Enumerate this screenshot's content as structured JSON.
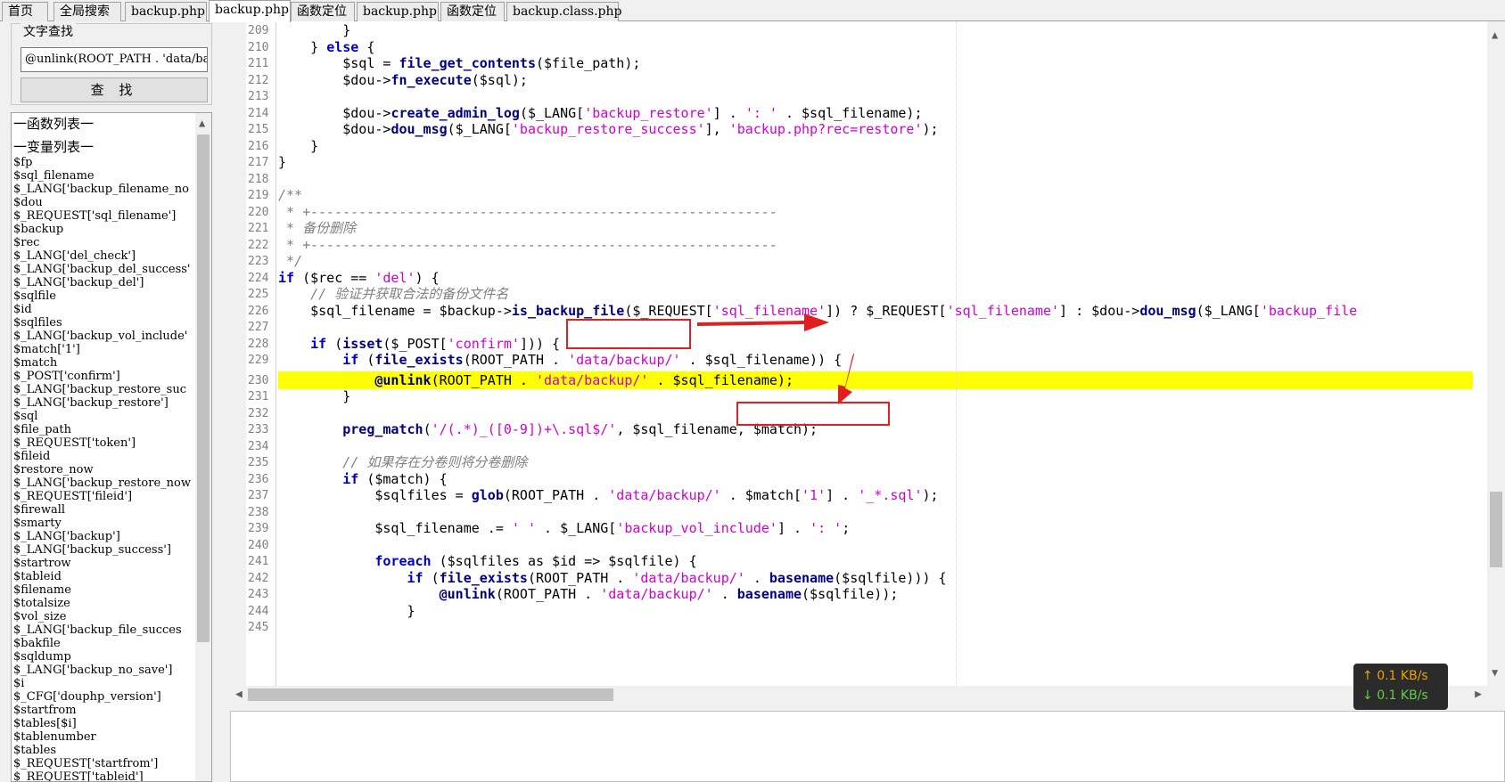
{
  "tabs": [
    {
      "label": "首页",
      "active": false
    },
    {
      "label": "全局搜索",
      "active": false
    },
    {
      "label": "backup.php",
      "active": false
    },
    {
      "label": "backup.php",
      "active": true
    },
    {
      "label": "函数定位",
      "active": false
    },
    {
      "label": "backup.php",
      "active": false
    },
    {
      "label": "函数定位",
      "active": false
    },
    {
      "label": "backup.class.php",
      "active": false
    }
  ],
  "find": {
    "title": "文字查找",
    "input_value": "@unlink(ROOT_PATH . 'data/ba",
    "button_label": "查 找"
  },
  "lists": {
    "functions_header": "一函数列表一",
    "variables_header": "一变量列表一",
    "variables": [
      "$fp",
      "$sql_filename",
      "$_LANG['backup_filename_no",
      "$dou",
      "$_REQUEST['sql_filename']",
      "$backup",
      "$rec",
      "$_LANG['del_check']",
      "$_LANG['backup_del_success'",
      "$_LANG['backup_del']",
      "$sqlfile",
      "$id",
      "$sqlfiles",
      "$_LANG['backup_vol_include'",
      "$match['1']",
      "$match",
      "$_POST['confirm']",
      "$_LANG['backup_restore_suc",
      "$_LANG['backup_restore']",
      "$sql",
      "$file_path",
      "$_REQUEST['token']",
      "$fileid",
      "$restore_now",
      "$_LANG['backup_restore_now'",
      "$_REQUEST['fileid']",
      "$firewall",
      "$smarty",
      "$_LANG['backup']",
      "$_LANG['backup_success']",
      "$startrow",
      "$tableid",
      "$filename",
      "$totalsize",
      "$vol_size",
      "$_LANG['backup_file_succes",
      "$bakfile",
      "$sqldump",
      "$_LANG['backup_no_save']",
      "$i",
      "$_CFG['douphp_version']",
      "$startfrom",
      "$tables[$i]",
      "$tablenumber",
      "$tables",
      "$_REQUEST['startfrom']",
      "$_REQUEST['tableid']"
    ]
  },
  "editor": {
    "line_numbers": [
      "209",
      "210",
      "211",
      "212",
      "213",
      "214",
      "215",
      "216",
      "217",
      "218",
      "219",
      "220",
      "221",
      "222",
      "223",
      "224",
      "225",
      "226",
      "227",
      "228",
      "229",
      "230",
      "231",
      "232",
      "233",
      "234",
      "235",
      "236",
      "237",
      "238",
      "239",
      "240",
      "241",
      "242",
      "243",
      "244",
      "245"
    ],
    "highlight_line": "230",
    "code": {
      "l209": "        }",
      "l210_a": "    } ",
      "l210_kw": "else",
      "l210_b": " {",
      "l211_a": "        $sql = ",
      "l211_fn": "file_get_contents",
      "l211_b": "($file_path);",
      "l212_a": "        $dou->",
      "l212_fn": "fn_execute",
      "l212_b": "($sql);",
      "l214_a": "        $dou->",
      "l214_fn": "create_admin_log",
      "l214_b": "($_LANG[",
      "l214_s1": "'backup_restore'",
      "l214_c": "] . ",
      "l214_s2": "': '",
      "l214_d": " . $sql_filename);",
      "l215_a": "        $dou->",
      "l215_fn": "dou_msg",
      "l215_b": "($_LANG[",
      "l215_s1": "'backup_restore_success'",
      "l215_c": "], ",
      "l215_s2": "'backup.php?rec=restore'",
      "l215_d": ");",
      "l216": "    }",
      "l217": "}",
      "l219": "/**",
      "l220": " * +----------------------------------------------------------",
      "l221": " * 备份删除",
      "l222": " * +----------------------------------------------------------",
      "l223": " */",
      "l224_kw": "if",
      "l224_a": " ($rec == ",
      "l224_s": "'del'",
      "l224_b": ") {",
      "l225": "    // 验证并获取合法的备份文件名",
      "l226_a": "    $sql_filename = $backup->",
      "l226_fn": "is_backup_file",
      "l226_b": "($_REQUEST[",
      "l226_s1": "'sql_filename'",
      "l226_c": "]) ? $_REQUEST[",
      "l226_s2": "'sql_filename'",
      "l226_d": "] : $dou->",
      "l226_fn2": "dou_msg",
      "l226_e": "($_LANG[",
      "l226_s3": "'backup_file",
      "l228_a": "    ",
      "l228_kw": "if",
      "l228_b": " (",
      "l228_fn": "isset",
      "l228_c": "($_POST[",
      "l228_s": "'confirm'",
      "l228_d": "])) {",
      "l229_a": "        ",
      "l229_kw": "if",
      "l229_b": " (",
      "l229_fn": "file_exists",
      "l229_c": "(ROOT_PATH . ",
      "l229_s": "'data/backup/'",
      "l229_d": " . $sql_filename)) {",
      "l230_a": "            ",
      "l230_fn": "@unlink",
      "l230_b": "(ROOT_PATH . ",
      "l230_s": "'data/backup/'",
      "l230_c": " . $sql_filename);",
      "l231": "        }",
      "l233_a": "        ",
      "l233_fn": "preg_match",
      "l233_b": "(",
      "l233_s": "'/(.*)_([0-9])+\\.sql$/'",
      "l233_c": ", $sql_filename, $match);",
      "l235": "        // 如果存在分卷则将分卷删除",
      "l236_a": "        ",
      "l236_kw": "if",
      "l236_b": " ($match) {",
      "l237_a": "            $sqlfiles = ",
      "l237_fn": "glob",
      "l237_b": "(ROOT_PATH . ",
      "l237_s1": "'data/backup/'",
      "l237_c": " . $match[",
      "l237_s2": "'1'",
      "l237_d": "] . ",
      "l237_s3": "'_*.sql'",
      "l237_e": ");",
      "l239_a": "            $sql_filename .= ",
      "l239_s1": "' '",
      "l239_b": " . $_LANG[",
      "l239_s2": "'backup_vol_include'",
      "l239_c": "] . ",
      "l239_s3": "': '",
      "l239_d": ";",
      "l241_a": "            ",
      "l241_kw": "foreach",
      "l241_b": " ($sqlfiles as $id => $sqlfile) {",
      "l242_a": "                ",
      "l242_kw": "if",
      "l242_b": " (",
      "l242_fn": "file_exists",
      "l242_c": "(ROOT_PATH . ",
      "l242_s": "'data/backup/'",
      "l242_d": " . ",
      "l242_fn2": "basename",
      "l242_e": "($sqlfile))) {",
      "l243_a": "                    ",
      "l243_fn": "@unlink",
      "l243_b": "(ROOT_PATH . ",
      "l243_s": "'data/backup/'",
      "l243_c": " . ",
      "l243_fn2": "basename",
      "l243_d": "($sqlfile));",
      "l244": "                }"
    }
  },
  "network": {
    "upload": "0.1 KB/s",
    "download": "0.1 KB/s"
  },
  "colors": {
    "highlight": "#ffff00",
    "annotation": "#e02020",
    "keyword": "#0000c0",
    "string": "#d000d0",
    "comment": "#808080"
  }
}
